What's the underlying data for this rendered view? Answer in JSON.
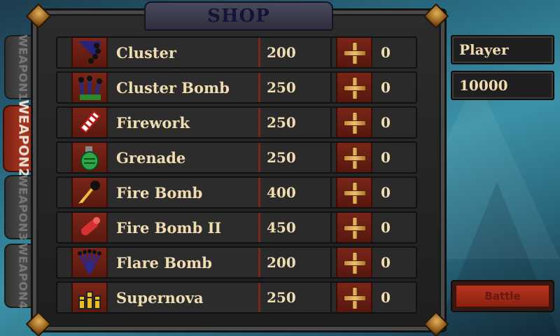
{
  "shop": {
    "title": "SHOP"
  },
  "tabs": [
    {
      "label": "WEAPON1",
      "active": false
    },
    {
      "label": "WEAPON2",
      "active": true
    },
    {
      "label": "WEAPON3",
      "active": false
    },
    {
      "label": "WEAPON4",
      "active": false
    }
  ],
  "items": [
    {
      "name": "Cluster",
      "price": "200",
      "count": "0",
      "icon": "cluster-icon"
    },
    {
      "name": "Cluster Bomb",
      "price": "250",
      "count": "0",
      "icon": "cluster-bomb-icon"
    },
    {
      "name": "Firework",
      "price": "250",
      "count": "0",
      "icon": "firework-icon"
    },
    {
      "name": "Grenade",
      "price": "250",
      "count": "0",
      "icon": "grenade-icon"
    },
    {
      "name": "Fire Bomb",
      "price": "400",
      "count": "0",
      "icon": "fire-bomb-icon"
    },
    {
      "name": "Fire Bomb II",
      "price": "450",
      "count": "0",
      "icon": "fire-bomb-ii-icon"
    },
    {
      "name": "Flare Bomb",
      "price": "200",
      "count": "0",
      "icon": "flare-bomb-icon"
    },
    {
      "name": "Supernova",
      "price": "250",
      "count": "0",
      "icon": "supernova-icon"
    }
  ],
  "player": {
    "name": "Player",
    "money": "10000"
  },
  "battle": {
    "label": "Battle"
  },
  "colors": {
    "accent_red": "#7a2518",
    "text_cream": "#f1dcb2",
    "title_navy": "#141438",
    "gold": "#d9a050"
  }
}
